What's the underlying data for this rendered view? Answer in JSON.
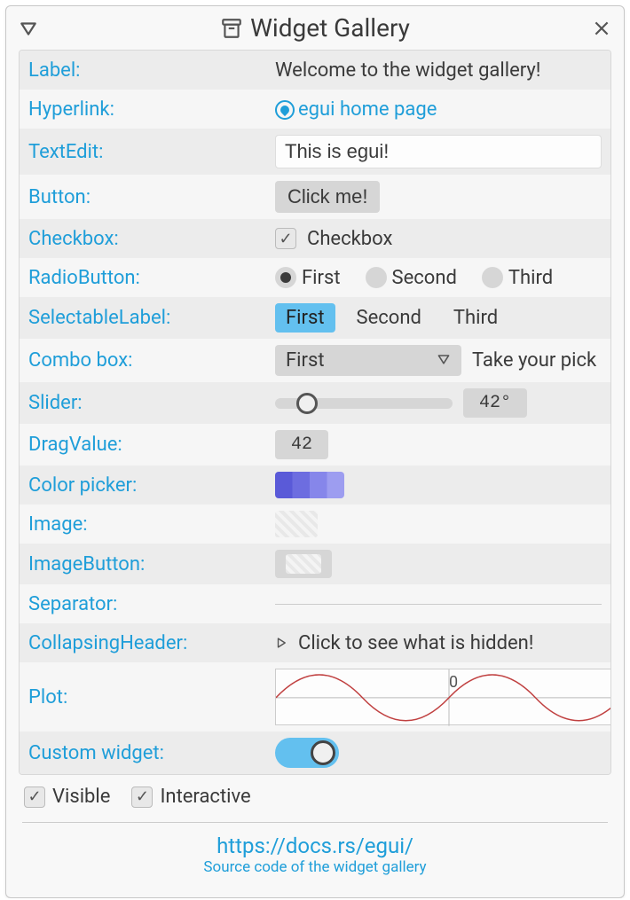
{
  "window": {
    "title": "Widget Gallery"
  },
  "rows": {
    "label": {
      "name": "Label:",
      "value": "Welcome to the widget gallery!"
    },
    "hyperlink": {
      "name": "Hyperlink:",
      "text": "egui home page"
    },
    "textedit": {
      "name": "TextEdit:",
      "value": "This is egui!"
    },
    "button": {
      "name": "Button:",
      "text": "Click me!"
    },
    "checkbox": {
      "name": "Checkbox:",
      "text": "Checkbox",
      "checked": true
    },
    "radio": {
      "name": "RadioButton:",
      "options": [
        "First",
        "Second",
        "Third"
      ],
      "selected": "First"
    },
    "selectable": {
      "name": "SelectableLabel:",
      "options": [
        "First",
        "Second",
        "Third"
      ],
      "selected": "First"
    },
    "combo": {
      "name": "Combo box:",
      "value": "First",
      "hint": "Take your pick"
    },
    "slider": {
      "name": "Slider:",
      "value": "42°"
    },
    "drag": {
      "name": "DragValue:",
      "value": "42"
    },
    "color": {
      "name": "Color picker:"
    },
    "image": {
      "name": "Image:"
    },
    "imagebtn": {
      "name": "ImageButton:"
    },
    "separator": {
      "name": "Separator:"
    },
    "collapse": {
      "name": "CollapsingHeader:",
      "text": "Click to see what is hidden!"
    },
    "plot": {
      "name": "Plot:",
      "zero": "0"
    },
    "custom": {
      "name": "Custom widget:"
    }
  },
  "footer": {
    "visible": "Visible",
    "interactive": "Interactive",
    "docs": "https://docs.rs/egui/",
    "source": "Source code of the widget gallery"
  }
}
